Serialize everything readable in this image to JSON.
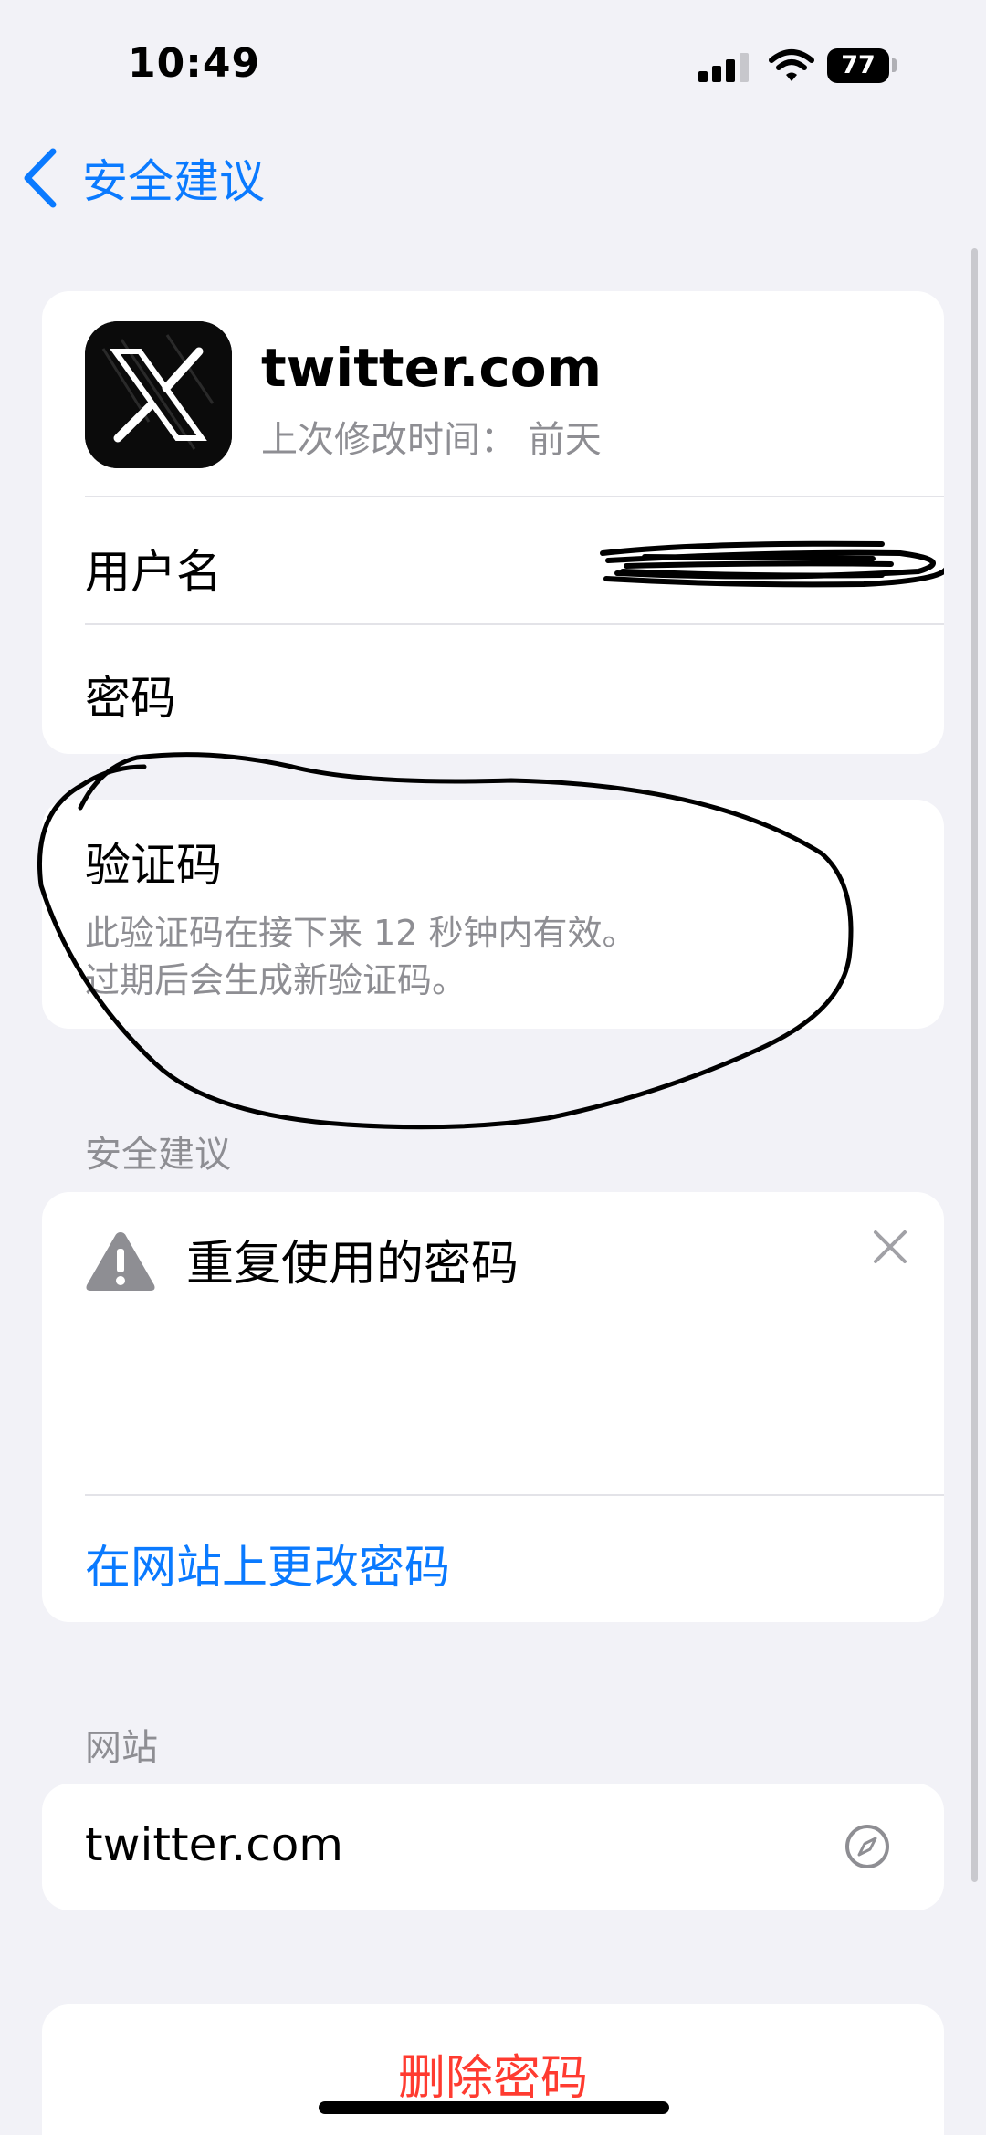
{
  "status_bar": {
    "time": "10:49",
    "battery": "77"
  },
  "nav": {
    "back_title": "安全建议"
  },
  "account": {
    "site": "twitter.com",
    "last_modified": "上次修改时间： 前天",
    "username_label": "用户名",
    "password_label": "密码"
  },
  "verification": {
    "title": "验证码",
    "line1": "此验证码在接下来 12 秒钟内有效。",
    "line2": "过期后会生成新验证码。"
  },
  "security": {
    "header": "安全建议",
    "warning": "重复使用的密码",
    "change_link": "在网站上更改密码"
  },
  "website": {
    "header": "网站",
    "url": "twitter.com"
  },
  "delete": {
    "label": "删除密码"
  },
  "colors": {
    "accent": "#0a7aff",
    "destructive": "#ff3b30",
    "background": "#f2f2f7"
  }
}
